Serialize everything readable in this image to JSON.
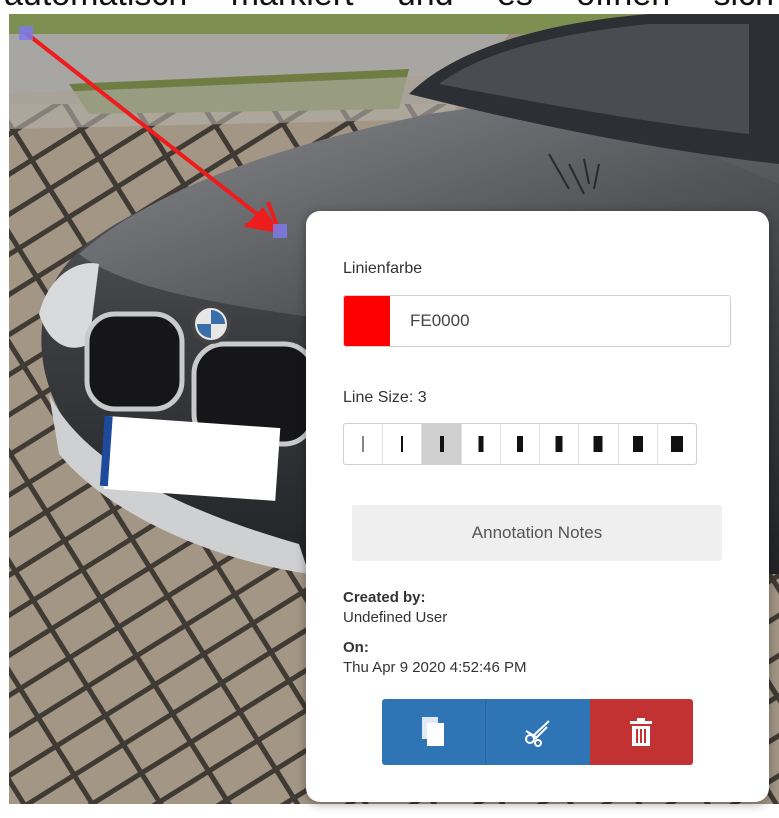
{
  "document": {
    "cropped_text": "automatisch markiert und es öffnen sich"
  },
  "annotation": {
    "color_label": "Linienfarbe",
    "color_value": "FE0000",
    "color_hex": "#FE0000",
    "line_size_label": "Line Size: 3",
    "line_size_selected": 3,
    "line_size_options": [
      1,
      2,
      3,
      4,
      5,
      6,
      7,
      8,
      9
    ],
    "notes_button": "Annotation Notes",
    "created_by_label": "Created by:",
    "created_by_value": "Undefined User",
    "on_label": "On:",
    "on_value": "Thu Apr 9 2020 4:52:46 PM",
    "actions": {
      "copy_icon": "copy-icon",
      "cut_icon": "scissors-icon",
      "delete_icon": "trash-icon",
      "copy_color": "#2f74b5",
      "delete_color": "#c23232"
    },
    "arrow_color": "#ee1c1c",
    "handle_color": "#7b7bea"
  }
}
